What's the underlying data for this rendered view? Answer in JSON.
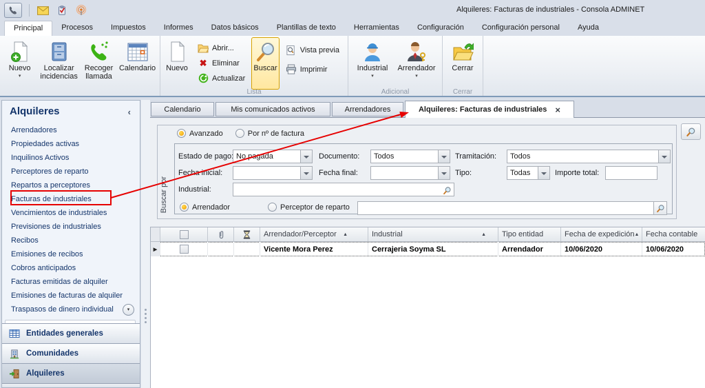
{
  "window": {
    "title": "Alquileres: Facturas de industriales - Consola ADMINET"
  },
  "quick_access": {
    "icons": [
      "phone-icon",
      "mail-icon",
      "clipboard-check-icon",
      "broadcast-icon"
    ]
  },
  "ribbon": {
    "tabs": [
      {
        "label": "Principal",
        "active": true
      },
      {
        "label": "Procesos"
      },
      {
        "label": "Impuestos"
      },
      {
        "label": "Informes"
      },
      {
        "label": "Datos básicos"
      },
      {
        "label": "Plantillas de texto"
      },
      {
        "label": "Herramientas"
      },
      {
        "label": "Configuración"
      },
      {
        "label": "Configuración personal"
      },
      {
        "label": "Ayuda"
      }
    ],
    "groups": {
      "main": {
        "nuevo": "Nuevo",
        "localizar_incidencias": "Localizar incidencias",
        "recoger_llamada": "Recoger llamada",
        "calendario": "Calendario"
      },
      "lista": {
        "label": "Lista",
        "nuevo": "Nuevo",
        "abrir": "Abrir...",
        "eliminar": "Eliminar",
        "actualizar": "Actualizar",
        "buscar": "Buscar",
        "vista_previa": "Vista previa",
        "imprimir": "Imprimir"
      },
      "adicional": {
        "label": "Adicional",
        "industrial": "Industrial",
        "arrendador": "Arrendador"
      },
      "cerrar": {
        "label": "Cerrar",
        "cerrar": "Cerrar"
      }
    }
  },
  "sidebar": {
    "header": "Alquileres",
    "items": [
      {
        "label": "Arrendadores"
      },
      {
        "label": "Propiedades activas"
      },
      {
        "label": "Inquilinos Activos"
      },
      {
        "label": "Perceptores de reparto"
      },
      {
        "label": "Repartos a perceptores"
      },
      {
        "label": "Facturas de industriales",
        "highlighted": true
      },
      {
        "label": "Vencimientos de industriales"
      },
      {
        "label": "Previsiones de industriales"
      },
      {
        "label": "Recibos"
      },
      {
        "label": "Emisiones de recibos"
      },
      {
        "label": "Cobros anticipados"
      },
      {
        "label": "Facturas emitidas de alquiler"
      },
      {
        "label": "Emisiones de facturas de alquiler"
      },
      {
        "label": "Traspasos de dinero individual"
      }
    ],
    "sections": [
      {
        "label": "Entidades generales",
        "icon": "table-icon"
      },
      {
        "label": "Comunidades",
        "icon": "building-icon"
      },
      {
        "label": "Alquileres",
        "icon": "door-icon",
        "selected": true
      }
    ]
  },
  "document_tabs": [
    {
      "label": "Calendario"
    },
    {
      "label": "Mis comunicados activos"
    },
    {
      "label": "Arrendadores"
    },
    {
      "label": "Alquileres: Facturas de industriales",
      "active": true,
      "closable": true
    }
  ],
  "search_panel": {
    "side_label": "Buscar por",
    "mode_options": [
      {
        "label": "Avanzado",
        "selected": true
      },
      {
        "label": "Por nº de factura",
        "selected": false
      }
    ],
    "estado_de_pago": {
      "label": "Estado de pago:",
      "value": "No pagada"
    },
    "documento": {
      "label": "Documento:",
      "value": "Todos"
    },
    "tramitacion": {
      "label": "Tramitación:",
      "value": "Todos"
    },
    "fecha_inicial": {
      "label": "Fecha inicial:",
      "value": ""
    },
    "fecha_final": {
      "label": "Fecha final:",
      "value": ""
    },
    "tipo": {
      "label": "Tipo:",
      "value": "Todas"
    },
    "importe_total": {
      "label": "Importe total:",
      "value": ""
    },
    "industrial": {
      "label": "Industrial:",
      "value": ""
    },
    "entity_options": [
      {
        "label": "Arrendador",
        "selected": true
      },
      {
        "label": "Perceptor de reparto",
        "selected": false
      }
    ],
    "entity_value": ""
  },
  "grid": {
    "header_icons": [
      "select-checkbox",
      "attachment-icon",
      "hourglass-icon"
    ],
    "columns": [
      {
        "label": "Arrendador/Perceptor",
        "sorted": "asc"
      },
      {
        "label": "Industrial",
        "sorted": "asc"
      },
      {
        "label": "Tipo entidad"
      },
      {
        "label": "Fecha de expedición",
        "sorted": "asc"
      },
      {
        "label": "Fecha contable"
      }
    ],
    "rows": [
      {
        "arrendador_perceptor": "Vicente Mora Perez",
        "industrial": "Cerrajeria Soyma SL",
        "tipo_entidad": "Arrendador",
        "fecha_expedicion": "10/06/2020",
        "fecha_contable": "10/06/2020"
      }
    ]
  },
  "glyphs": {
    "caret": "▾",
    "sort_asc": "▲",
    "tab_close": "×",
    "collapse": "‹",
    "row_pointer": "▶",
    "delete_x": "✖"
  },
  "colors": {
    "annotation_red": "#e60000",
    "selected_button_border": "#d8a200",
    "navy_text": "#14356b"
  }
}
